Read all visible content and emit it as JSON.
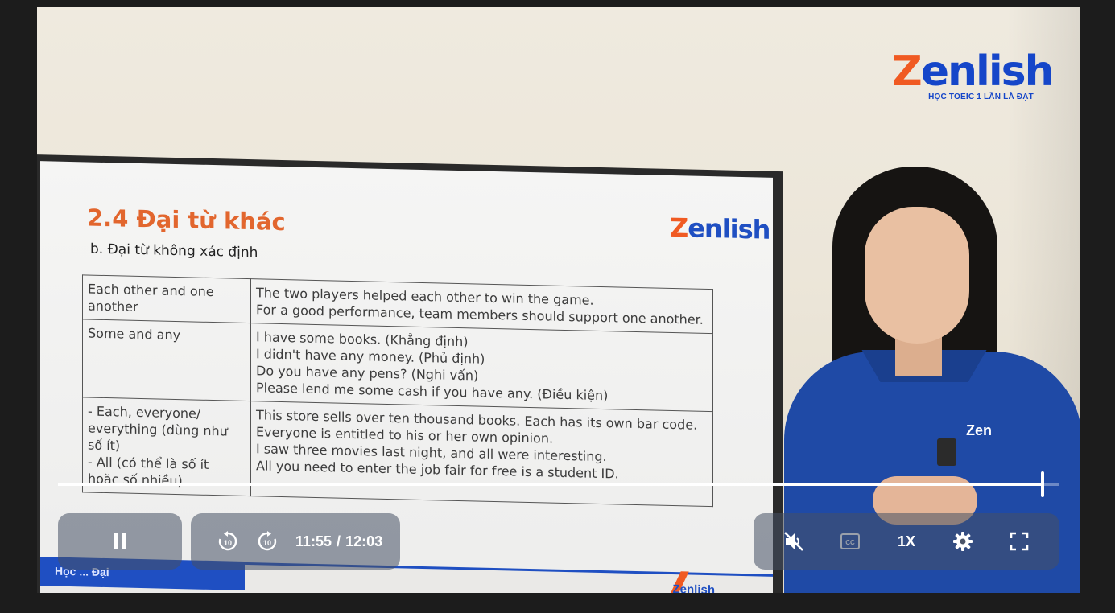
{
  "brand": {
    "logo_text": "Zenlish",
    "logo_z": "Z",
    "logo_rest": "enlish",
    "tagline": "HỌC TOEIC 1 LẦN LÀ ĐẠT"
  },
  "slide": {
    "title": "2.4 Đại từ khác",
    "subtitle": "b. Đại từ không xác định",
    "logo_z": "Z",
    "logo_rest": "enlish",
    "rows": [
      {
        "term_lines": [
          "Each other and one",
          "another"
        ],
        "examples": [
          "The two players helped each other to win the game.",
          "For a good performance, team members should support one another."
        ]
      },
      {
        "term_lines": [
          "Some and any"
        ],
        "examples": [
          "I have some books. (Khẳng định)",
          "I didn't have any money. (Phủ định)",
          "Do you have any pens? (Nghi vấn)",
          "Please lend me some cash if you have any. (Điều kiện)"
        ]
      },
      {
        "term_lines": [
          "- Each, everyone/",
          "everything (dùng như",
          "số ít)",
          "- All (có thể là số ít",
          "hoặc số nhiều)"
        ],
        "examples": [
          "This store sells over ten thousand books. Each has its own bar code.",
          "Everyone is entitled to his or her own opinion.",
          "I saw three movies last night, and all were interesting.",
          "All you need to enter the job fair for free is a student ID."
        ]
      }
    ],
    "footer_tab": "Học ... Đại",
    "footer_logo": "Zenlish"
  },
  "presenter": {
    "shirt_logo": "Zen"
  },
  "player": {
    "current_time": "11:55",
    "separator": "/",
    "duration": "12:03",
    "progress_fraction": 0.983,
    "speed": "1X",
    "muted": true,
    "icons": {
      "play_pause": "pause-icon",
      "rewind": "rewind-10-icon",
      "forward": "forward-10-icon",
      "volume": "volume-muted-icon",
      "captions": "closed-captions-icon",
      "settings": "gear-icon",
      "fullscreen": "fullscreen-icon"
    }
  }
}
